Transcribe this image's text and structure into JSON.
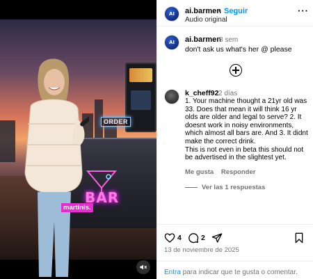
{
  "post": {
    "username": "ai.barmen",
    "separator": "•",
    "follow_label": "Seguir",
    "audio_label": "Audio original",
    "more_label": "···",
    "avatar_text": "AI"
  },
  "video": {
    "caption": "martinis.",
    "order_sign": "ORDER",
    "bar_sign": "BAR",
    "muted": true
  },
  "comments": [
    {
      "username": "ai.barmen",
      "time": "8 sem",
      "text": "don't ask us what's her @ please"
    },
    {
      "username": "k_cheff92",
      "time": "2 días",
      "text": "1. Your machine thought a 21yr old was\n33. Does that mean it will think 16 yr\nolds are older and legal to serve? 2. It\ndoesnt work in noisy environments,\nwhich almost all bars are. And 3. It didnt\nmake the correct drink.\nThis is not even in beta this should not\nbe advertised in the slightest yet.",
      "like_label": "Me gusta",
      "reply_label": "Responder",
      "view_replies": "Ver las 1 respuestas"
    }
  ],
  "engagement": {
    "likes": "4",
    "comments": "2",
    "date": "13 de noviembre de 2025"
  },
  "login_prompt": {
    "link": "Entra",
    "rest": " para indicar que te gusta o comentar."
  }
}
